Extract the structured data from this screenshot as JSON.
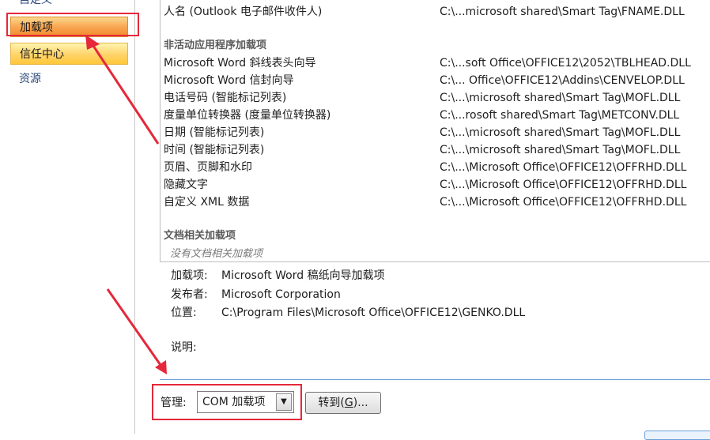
{
  "sidebar": {
    "items": [
      {
        "label": "自定义"
      },
      {
        "label": "加载项"
      },
      {
        "label": "信任中心"
      },
      {
        "label": "资源"
      }
    ]
  },
  "list": {
    "top_partial": {
      "name": "人名 (Outlook 电子邮件收件人)",
      "path": "C:\\...microsoft shared\\Smart Tag\\FNAME.DLL"
    },
    "inactive_header": "非活动应用程序加载项",
    "inactive_items": [
      {
        "name": "Microsoft Word 斜线表头向导",
        "path": "C:\\...soft Office\\OFFICE12\\2052\\TBLHEAD.DLL"
      },
      {
        "name": "Microsoft Word 信封向导",
        "path": "C:\\... Office\\OFFICE12\\Addins\\CENVELOP.DLL"
      },
      {
        "name": "电话号码 (智能标记列表)",
        "path": "C:\\...\\microsoft shared\\Smart Tag\\MOFL.DLL"
      },
      {
        "name": "度量单位转换器 (度量单位转换器)",
        "path": "C:\\...rosoft shared\\Smart Tag\\METCONV.DLL"
      },
      {
        "name": "日期 (智能标记列表)",
        "path": "C:\\...\\microsoft shared\\Smart Tag\\MOFL.DLL"
      },
      {
        "name": "时间 (智能标记列表)",
        "path": "C:\\...\\microsoft shared\\Smart Tag\\MOFL.DLL"
      },
      {
        "name": "页眉、页脚和水印",
        "path": "C:\\...\\Microsoft Office\\OFFICE12\\OFFRHD.DLL"
      },
      {
        "name": "隐藏文字",
        "path": "C:\\...\\Microsoft Office\\OFFICE12\\OFFRHD.DLL"
      },
      {
        "name": "自定义 XML 数据",
        "path": "C:\\...\\Microsoft Office\\OFFICE12\\OFFRHD.DLL"
      }
    ],
    "doc_header": "文档相关加载项",
    "doc_empty": "没有文档相关加载项"
  },
  "details": {
    "addin_label": "加载项:",
    "addin_value": "Microsoft Word 稿纸向导加载项",
    "publisher_label": "发布者:",
    "publisher_value": "Microsoft Corporation",
    "location_label": "位置:",
    "location_value": "C:\\Program Files\\Microsoft Office\\OFFICE12\\GENKO.DLL",
    "description_label": "说明:"
  },
  "manage": {
    "label": "管理:",
    "selected": "COM 加载项",
    "goto_label": "转到(G)...",
    "goto_accel": "G"
  },
  "colors": {
    "active_nav": "#f9a653",
    "hover_nav": "#ffd36a",
    "annotation_red": "#e5283a"
  }
}
